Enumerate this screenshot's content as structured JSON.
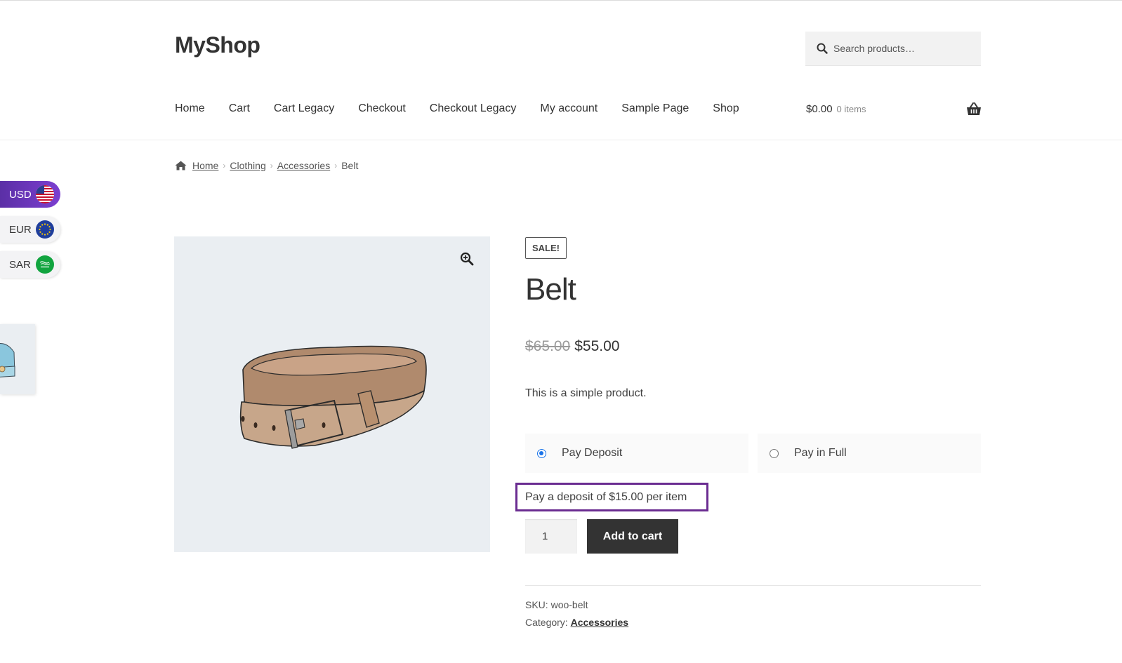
{
  "site": {
    "title": "MyShop"
  },
  "search": {
    "placeholder": "Search products…"
  },
  "nav": {
    "items": [
      "Home",
      "Cart",
      "Cart Legacy",
      "Checkout",
      "Checkout Legacy",
      "My account",
      "Sample Page",
      "Shop"
    ]
  },
  "cart": {
    "total": "$0.00",
    "count": "0 items"
  },
  "breadcrumb": {
    "home": "Home",
    "clothing": "Clothing",
    "accessories": "Accessories",
    "current": "Belt"
  },
  "currency_switcher": [
    {
      "code": "USD",
      "active": true
    },
    {
      "code": "EUR",
      "active": false
    },
    {
      "code": "SAR",
      "active": false
    }
  ],
  "product": {
    "badge": "SALE!",
    "title": "Belt",
    "price_old": "$65.00",
    "price_new": "$55.00",
    "short_description": "This is a simple product.",
    "payment_options": {
      "deposit": "Pay Deposit",
      "full": "Pay in Full",
      "selected": "deposit"
    },
    "deposit_note": "Pay a deposit of $15.00 per item",
    "quantity": "1",
    "add_to_cart_label": "Add to cart",
    "sku_label": "SKU:",
    "sku_value": "woo-belt",
    "category_label": "Category:",
    "category_value": "Accessories"
  },
  "colors": {
    "accent_purple": "#6a2c91",
    "currency_active": "#6b38c0",
    "button_dark": "#333333",
    "radio_blue": "#1a73e8"
  },
  "icons": [
    "search-icon",
    "basket-icon",
    "home-icon",
    "zoom-in-icon",
    "us-flag-icon",
    "eu-flag-icon",
    "sa-flag-icon"
  ]
}
